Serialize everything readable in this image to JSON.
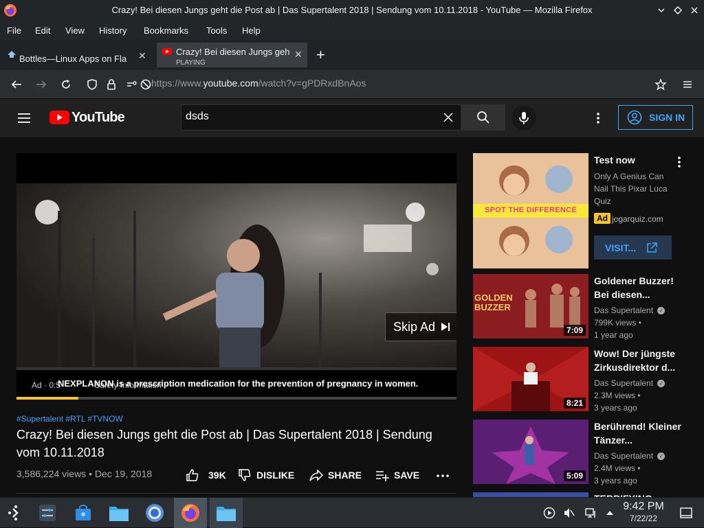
{
  "window": {
    "title": "Crazy! Bei diesen Jungs geht die Post ab | Das Supertalent 2018 | Sendung vom 10.11.2018 - YouTube — Mozilla Firefox"
  },
  "menu": [
    "File",
    "Edit",
    "View",
    "History",
    "Bookmarks",
    "Tools",
    "Help"
  ],
  "tabs": [
    {
      "label": "Bottles—Linux Apps on Fla",
      "status": ""
    },
    {
      "label": "Crazy! Bei diesen Jungs geh",
      "status": "PLAYING"
    }
  ],
  "navbar": {
    "url_prefix": "https://www.",
    "url_host": "youtube.com",
    "url_path": "/watch?v=gPDRxdBnAos"
  },
  "youtube": {
    "logo_text": "YouTube",
    "search_value": "dsds",
    "sign_in": "SIGN IN"
  },
  "player": {
    "skip_ad": "Skip Ad",
    "ad_info": "Ad · 0:5",
    "ad_info_tail": "Safety Information",
    "caption": "NEXPLANON is a prescription medication for the prevention of pregnancy in women.",
    "progress": 0.14
  },
  "video": {
    "tags": "#Supertalent #RTL #TVNOW",
    "title": "Crazy! Bei diesen Jungs geht die Post ab | Das Supertalent 2018 | Sendung vom 10.11.2018",
    "views_date": "3,586,224 views • Dec 19, 2018",
    "likes": "39K",
    "dislike": "DISLIKE",
    "share": "SHARE",
    "save": "SAVE"
  },
  "ad_card": {
    "thumb_text": "SPOT THE DIFFERENCE",
    "title": "Test now",
    "desc": "Only A Genius Can Nail This Pixar Luca Quiz",
    "badge": "Ad",
    "domain": "jogarquiz.com",
    "visit": "VISIT..."
  },
  "related": [
    {
      "thumb_text": "GOLDEN BUZZER",
      "title": "Goldener Buzzer! Bei diesen...",
      "channel": "Das Supertalent",
      "views": "799K views •",
      "age": "1 year ago",
      "duration": "7:09"
    },
    {
      "thumb_text": "",
      "title": "Wow! Der jüngste Zirkusdirektor d...",
      "channel": "Das Supertalent",
      "views": "2.3M views •",
      "age": "3 years ago",
      "duration": "8:21"
    },
    {
      "thumb_text": "",
      "title": "Berührend! Kleiner Tänzer...",
      "channel": "Das Supertalent",
      "views": "2.4M views •",
      "age": "3 years ago",
      "duration": "5:09"
    },
    {
      "thumb_text": "",
      "title": "TERRIFYING",
      "channel": "",
      "views": "",
      "age": "",
      "duration": ""
    }
  ],
  "taskbar": {
    "time": "9:42 PM",
    "date": "7/22/22"
  },
  "colors": {
    "yt_red": "#ff0000",
    "link_blue": "#3ea6ff",
    "ad_yellow": "#f8c430"
  }
}
